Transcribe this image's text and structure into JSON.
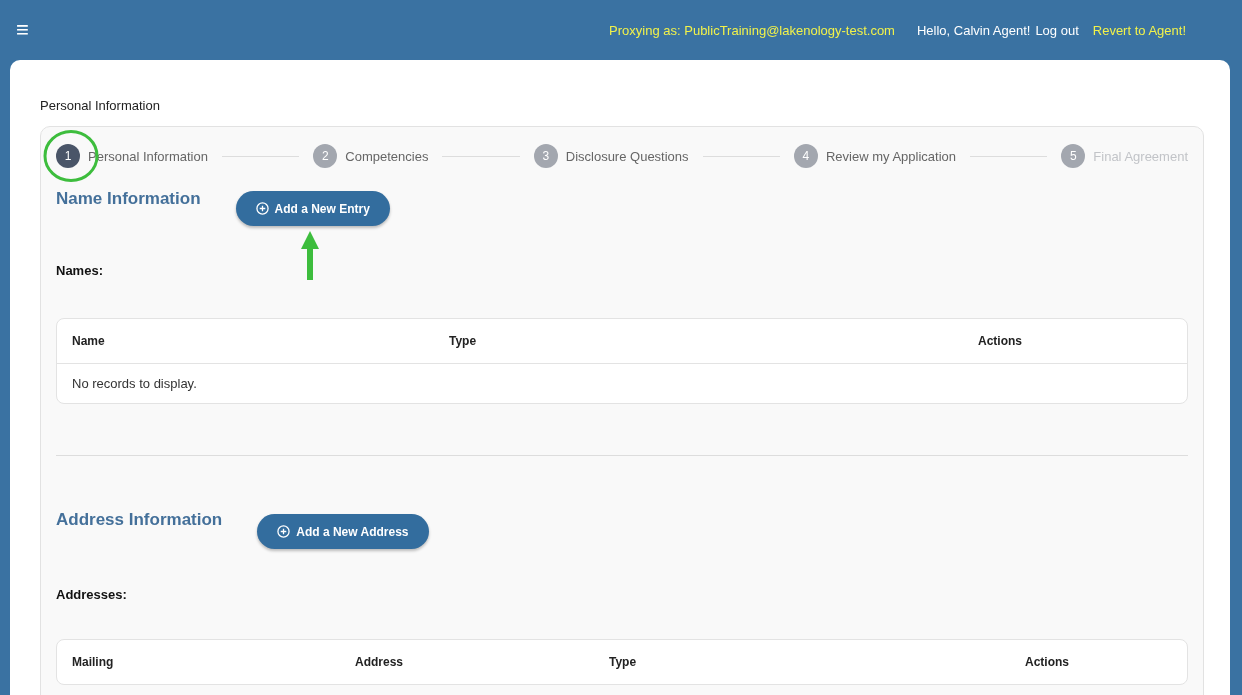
{
  "top_bar": {
    "menu_icon": "≡",
    "proxy_text": "Proxying as: PublicTraining@lakenology-test.com",
    "greeting": "Hello, Calvin Agent!",
    "logout": "Log out",
    "revert": "Revert to Agent!"
  },
  "page_title": "Personal Information",
  "steps": [
    {
      "number": "1",
      "label": "Personal Information",
      "selected": true,
      "disabled": false
    },
    {
      "number": "2",
      "label": "Competencies",
      "selected": false,
      "disabled": false
    },
    {
      "number": "3",
      "label": "Disclosure Questions",
      "selected": false,
      "disabled": false
    },
    {
      "number": "4",
      "label": "Review my Application",
      "selected": false,
      "disabled": false
    },
    {
      "number": "5",
      "label": "Final Agreement",
      "selected": false,
      "disabled": true
    }
  ],
  "sections": [
    {
      "heading": "Name Information",
      "button": "Add a New Entry",
      "list_label": "Names:",
      "annotated": true,
      "columns": [
        "Name",
        "Type",
        "Actions"
      ],
      "empty_text": "No records to display."
    },
    {
      "heading": "Address Information",
      "button": "Add a New Address",
      "list_label": "Addresses:",
      "columns": [
        "Mailing",
        "Address",
        "Type",
        "Actions"
      ]
    }
  ]
}
